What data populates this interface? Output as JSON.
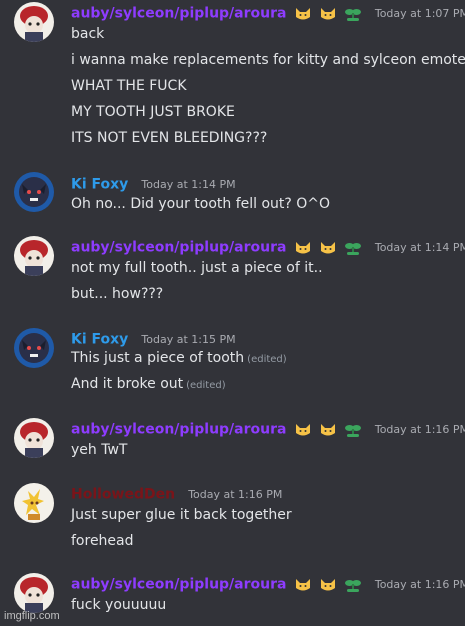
{
  "colors": {
    "background": "#323339",
    "auby": "#8e3cff",
    "kifoxy": "#2e9bea",
    "hollowed": "#7a1419",
    "timestamp": "#a9abb1"
  },
  "messages": [
    {
      "author": "auby/sylceon/piplup/aroura",
      "emotes": [
        "cat-emote",
        "cat-emote",
        "sprout-emote"
      ],
      "timestamp": "Today at 1:07 PM",
      "lines": [
        {
          "text": "back"
        },
        {
          "text": "i wanna make replacements for kitty and sylceon emotes"
        },
        {
          "text": "WHAT THE FUCK"
        },
        {
          "text": "MY TOOTH JUST BROKE"
        },
        {
          "text": "ITS NOT EVEN BLEEDING???"
        }
      ]
    },
    {
      "author": "Ki Foxy",
      "emotes": [],
      "timestamp": "Today at 1:14 PM",
      "lines": [
        {
          "text": "Oh no... Did your tooth fell out? O^O"
        }
      ]
    },
    {
      "author": "auby/sylceon/piplup/aroura",
      "emotes": [
        "cat-emote",
        "cat-emote",
        "sprout-emote"
      ],
      "timestamp": "Today at 1:14 PM",
      "lines": [
        {
          "text": "not my full tooth.. just a piece of it.."
        },
        {
          "text": "but... how???"
        }
      ]
    },
    {
      "author": "Ki Foxy",
      "emotes": [],
      "timestamp": "Today at 1:15 PM",
      "lines": [
        {
          "text": "This just a piece of tooth",
          "edited": "(edited)"
        },
        {
          "text": "And it broke out",
          "edited": "(edited)"
        }
      ]
    },
    {
      "author": "auby/sylceon/piplup/aroura",
      "emotes": [
        "cat-emote",
        "cat-emote",
        "sprout-emote"
      ],
      "timestamp": "Today at 1:16 PM",
      "lines": [
        {
          "text": "yeh TwT"
        }
      ]
    },
    {
      "author": "HollowedDen",
      "emotes": [],
      "timestamp": "Today at 1:16 PM",
      "lines": [
        {
          "text": "Just super glue it back together"
        },
        {
          "text": "forehead"
        }
      ]
    },
    {
      "author": "auby/sylceon/piplup/aroura",
      "emotes": [
        "cat-emote",
        "cat-emote",
        "sprout-emote"
      ],
      "timestamp": "Today at 1:16 PM",
      "lines": [
        {
          "text": "fuck youuuuu"
        }
      ]
    }
  ],
  "watermark": "imgflip.com"
}
